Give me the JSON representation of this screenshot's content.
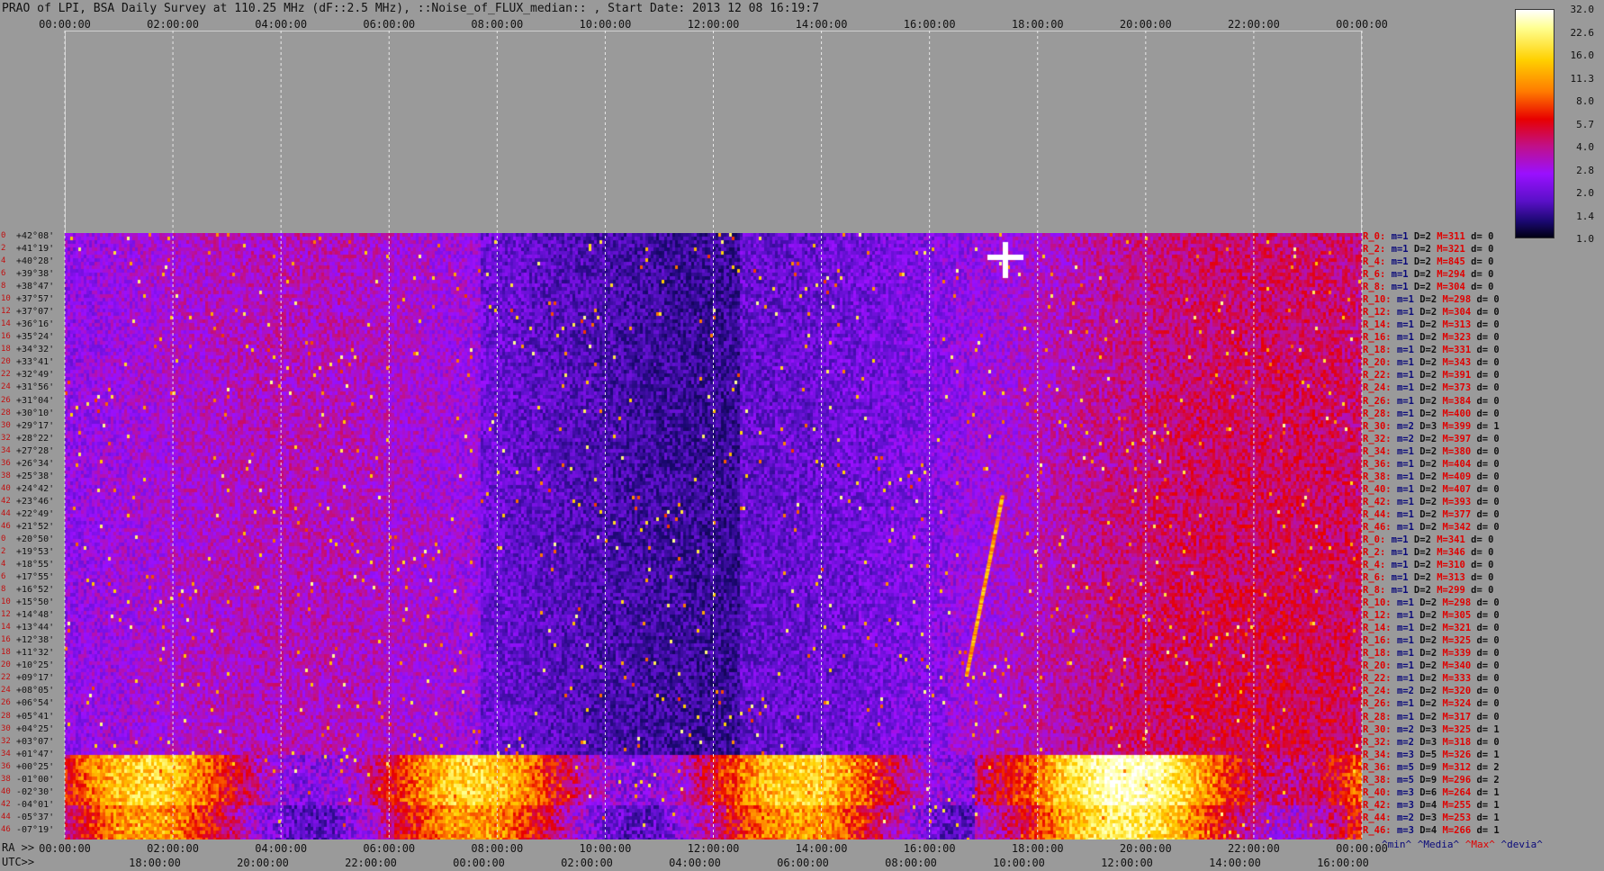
{
  "title": "PRAO of LPI, BSA Daily Survey at 110.25 MHz (dF::2.5 MHz), ::Noise_of_FLUX_median:: , Start Date: 2013 12 08 16:19:7",
  "axis": {
    "top_ticks": [
      "00:00:00",
      "02:00:00",
      "04:00:00",
      "06:00:00",
      "08:00:00",
      "10:00:00",
      "12:00:00",
      "14:00:00",
      "16:00:00",
      "18:00:00",
      "20:00:00",
      "22:00:00",
      "00:00:00"
    ],
    "ra_prefix": "RA >>",
    "ra_ticks": [
      "00:00:00",
      "02:00:00",
      "04:00:00",
      "06:00:00",
      "08:00:00",
      "10:00:00",
      "12:00:00",
      "14:00:00",
      "16:00:00",
      "18:00:00",
      "20:00:00",
      "22:00:00",
      "00:00:00"
    ],
    "utc_prefix": "UTC>>",
    "utc_ticks": [
      "18:00:00",
      "20:00:00",
      "22:00:00",
      "00:00:00",
      "02:00:00",
      "04:00:00",
      "06:00:00",
      "08:00:00",
      "10:00:00",
      "12:00:00",
      "14:00:00",
      "16:00:00"
    ]
  },
  "colorbar": {
    "labels": [
      "32.0",
      "22.6",
      "16.0",
      "11.3",
      "8.0",
      "5.7",
      "4.0",
      "2.8",
      "2.0",
      "1.4",
      "1.0"
    ]
  },
  "stats_legend": {
    "min": "^min^",
    "median": "^Media^",
    "max": "^Max^",
    "devia": "^devia^"
  },
  "chart_data": {
    "type": "heatmap",
    "title": "PRAO of LPI, BSA Daily Survey at 110.25 MHz (dF::2.5 MHz), ::Noise_of_FLUX_median:: , Start Date: 2013 12 08 16:19:7",
    "x_range_ra": [
      "00:00:00",
      "00:00:00"
    ],
    "colorscale": [
      "#000014",
      "#1a0870",
      "#5a10c8",
      "#9a10ff",
      "#c0108a",
      "#e80000",
      "#ff7a00",
      "#ffd000",
      "#ffff90",
      "#ffffff"
    ],
    "color_range": [
      1.0,
      32.0
    ],
    "rows": [
      {
        "idx": "0",
        "dec": "+42°08'",
        "r": "R_0:",
        "m": "m=1",
        "d": "D=2",
        "M": "M=311",
        "dv": "d= 0"
      },
      {
        "idx": "2",
        "dec": "+41°19'",
        "r": "R_2:",
        "m": "m=1",
        "d": "D=2",
        "M": "M=321",
        "dv": "d= 0"
      },
      {
        "idx": "4",
        "dec": "+40°28'",
        "r": "R_4:",
        "m": "m=1",
        "d": "D=2",
        "M": "M=845",
        "dv": "d= 0"
      },
      {
        "idx": "6",
        "dec": "+39°38'",
        "r": "R_6:",
        "m": "m=1",
        "d": "D=2",
        "M": "M=294",
        "dv": "d= 0"
      },
      {
        "idx": "8",
        "dec": "+38°47'",
        "r": "R_8:",
        "m": "m=1",
        "d": "D=2",
        "M": "M=304",
        "dv": "d= 0"
      },
      {
        "idx": "10",
        "dec": "+37°57'",
        "r": "R_10:",
        "m": "m=1",
        "d": "D=2",
        "M": "M=298",
        "dv": "d= 0"
      },
      {
        "idx": "12",
        "dec": "+37°07'",
        "r": "R_12:",
        "m": "m=1",
        "d": "D=2",
        "M": "M=304",
        "dv": "d= 0"
      },
      {
        "idx": "14",
        "dec": "+36°16'",
        "r": "R_14:",
        "m": "m=1",
        "d": "D=2",
        "M": "M=313",
        "dv": "d= 0"
      },
      {
        "idx": "16",
        "dec": "+35°24'",
        "r": "R_16:",
        "m": "m=1",
        "d": "D=2",
        "M": "M=323",
        "dv": "d= 0"
      },
      {
        "idx": "18",
        "dec": "+34°32'",
        "r": "R_18:",
        "m": "m=1",
        "d": "D=2",
        "M": "M=331",
        "dv": "d= 0"
      },
      {
        "idx": "20",
        "dec": "+33°41'",
        "r": "R_20:",
        "m": "m=1",
        "d": "D=2",
        "M": "M=343",
        "dv": "d= 0"
      },
      {
        "idx": "22",
        "dec": "+32°49'",
        "r": "R_22:",
        "m": "m=1",
        "d": "D=2",
        "M": "M=391",
        "dv": "d= 0"
      },
      {
        "idx": "24",
        "dec": "+31°56'",
        "r": "R_24:",
        "m": "m=1",
        "d": "D=2",
        "M": "M=373",
        "dv": "d= 0"
      },
      {
        "idx": "26",
        "dec": "+31°04'",
        "r": "R_26:",
        "m": "m=1",
        "d": "D=2",
        "M": "M=384",
        "dv": "d= 0"
      },
      {
        "idx": "28",
        "dec": "+30°10'",
        "r": "R_28:",
        "m": "m=1",
        "d": "D=2",
        "M": "M=400",
        "dv": "d= 0"
      },
      {
        "idx": "30",
        "dec": "+29°17'",
        "r": "R_30:",
        "m": "m=2",
        "d": "D=3",
        "M": "M=399",
        "dv": "d= 1"
      },
      {
        "idx": "32",
        "dec": "+28°22'",
        "r": "R_32:",
        "m": "m=2",
        "d": "D=2",
        "M": "M=397",
        "dv": "d= 0"
      },
      {
        "idx": "34",
        "dec": "+27°28'",
        "r": "R_34:",
        "m": "m=1",
        "d": "D=2",
        "M": "M=380",
        "dv": "d= 0"
      },
      {
        "idx": "36",
        "dec": "+26°34'",
        "r": "R_36:",
        "m": "m=1",
        "d": "D=2",
        "M": "M=404",
        "dv": "d= 0"
      },
      {
        "idx": "38",
        "dec": "+25°38'",
        "r": "R_38:",
        "m": "m=1",
        "d": "D=2",
        "M": "M=409",
        "dv": "d= 0"
      },
      {
        "idx": "40",
        "dec": "+24°42'",
        "r": "R_40:",
        "m": "m=1",
        "d": "D=2",
        "M": "M=407",
        "dv": "d= 0"
      },
      {
        "idx": "42",
        "dec": "+23°46'",
        "r": "R_42:",
        "m": "m=1",
        "d": "D=2",
        "M": "M=393",
        "dv": "d= 0"
      },
      {
        "idx": "44",
        "dec": "+22°49'",
        "r": "R_44:",
        "m": "m=1",
        "d": "D=2",
        "M": "M=377",
        "dv": "d= 0"
      },
      {
        "idx": "46",
        "dec": "+21°52'",
        "r": "R_46:",
        "m": "m=1",
        "d": "D=2",
        "M": "M=342",
        "dv": "d= 0"
      },
      {
        "idx": "0",
        "dec": "+20°50'",
        "r": "R_0:",
        "m": "m=1",
        "d": "D=2",
        "M": "M=341",
        "dv": "d= 0"
      },
      {
        "idx": "2",
        "dec": "+19°53'",
        "r": "R_2:",
        "m": "m=1",
        "d": "D=2",
        "M": "M=346",
        "dv": "d= 0"
      },
      {
        "idx": "4",
        "dec": "+18°55'",
        "r": "R_4:",
        "m": "m=1",
        "d": "D=2",
        "M": "M=310",
        "dv": "d= 0"
      },
      {
        "idx": "6",
        "dec": "+17°55'",
        "r": "R_6:",
        "m": "m=1",
        "d": "D=2",
        "M": "M=313",
        "dv": "d= 0"
      },
      {
        "idx": "8",
        "dec": "+16°52'",
        "r": "R_8:",
        "m": "m=1",
        "d": "D=2",
        "M": "M=299",
        "dv": "d= 0"
      },
      {
        "idx": "10",
        "dec": "+15°50'",
        "r": "R_10:",
        "m": "m=1",
        "d": "D=2",
        "M": "M=298",
        "dv": "d= 0"
      },
      {
        "idx": "12",
        "dec": "+14°48'",
        "r": "R_12:",
        "m": "m=1",
        "d": "D=2",
        "M": "M=305",
        "dv": "d= 0"
      },
      {
        "idx": "14",
        "dec": "+13°44'",
        "r": "R_14:",
        "m": "m=1",
        "d": "D=2",
        "M": "M=321",
        "dv": "d= 0"
      },
      {
        "idx": "16",
        "dec": "+12°38'",
        "r": "R_16:",
        "m": "m=1",
        "d": "D=2",
        "M": "M=325",
        "dv": "d= 0"
      },
      {
        "idx": "18",
        "dec": "+11°32'",
        "r": "R_18:",
        "m": "m=1",
        "d": "D=2",
        "M": "M=339",
        "dv": "d= 0"
      },
      {
        "idx": "20",
        "dec": "+10°25'",
        "r": "R_20:",
        "m": "m=1",
        "d": "D=2",
        "M": "M=340",
        "dv": "d= 0"
      },
      {
        "idx": "22",
        "dec": "+09°17'",
        "r": "R_22:",
        "m": "m=1",
        "d": "D=2",
        "M": "M=333",
        "dv": "d= 0"
      },
      {
        "idx": "24",
        "dec": "+08°05'",
        "r": "R_24:",
        "m": "m=2",
        "d": "D=2",
        "M": "M=320",
        "dv": "d= 0"
      },
      {
        "idx": "26",
        "dec": "+06°54'",
        "r": "R_26:",
        "m": "m=1",
        "d": "D=2",
        "M": "M=324",
        "dv": "d= 0"
      },
      {
        "idx": "28",
        "dec": "+05°41'",
        "r": "R_28:",
        "m": "m=1",
        "d": "D=2",
        "M": "M=317",
        "dv": "d= 0"
      },
      {
        "idx": "30",
        "dec": "+04°25'",
        "r": "R_30:",
        "m": "m=2",
        "d": "D=3",
        "M": "M=325",
        "dv": "d= 1"
      },
      {
        "idx": "32",
        "dec": "+03°07'",
        "r": "R_32:",
        "m": "m=2",
        "d": "D=3",
        "M": "M=318",
        "dv": "d= 0"
      },
      {
        "idx": "34",
        "dec": "+01°47'",
        "r": "R_34:",
        "m": "m=3",
        "d": "D=5",
        "M": "M=326",
        "dv": "d= 1"
      },
      {
        "idx": "36",
        "dec": "+00°25'",
        "r": "R_36:",
        "m": "m=5",
        "d": "D=9",
        "M": "M=312",
        "dv": "d= 2"
      },
      {
        "idx": "38",
        "dec": "-01°00'",
        "r": "R_38:",
        "m": "m=5",
        "d": "D=9",
        "M": "M=296",
        "dv": "d= 2"
      },
      {
        "idx": "40",
        "dec": "-02°30'",
        "r": "R_40:",
        "m": "m=3",
        "d": "D=6",
        "M": "M=264",
        "dv": "d= 1"
      },
      {
        "idx": "42",
        "dec": "-04°01'",
        "r": "R_42:",
        "m": "m=3",
        "d": "D=4",
        "M": "M=255",
        "dv": "d= 1"
      },
      {
        "idx": "44",
        "dec": "-05°37'",
        "r": "R_44:",
        "m": "m=2",
        "d": "D=3",
        "M": "M=253",
        "dv": "d= 1"
      },
      {
        "idx": "46",
        "dec": "-07°19'",
        "r": "R_46:",
        "m": "m=3",
        "d": "D=4",
        "M": "M=266",
        "dv": "d= 1"
      }
    ]
  }
}
